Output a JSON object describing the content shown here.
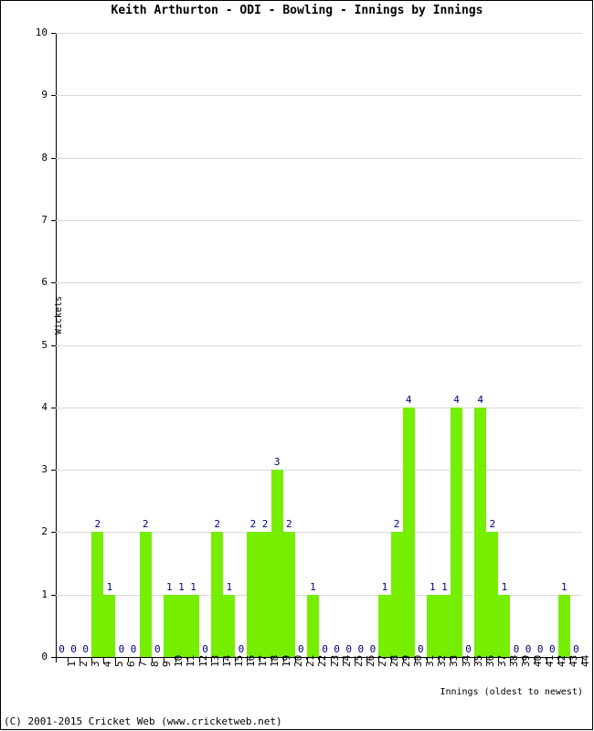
{
  "chart_data": {
    "type": "bar",
    "title": "Keith Arthurton - ODI - Bowling - Innings by Innings",
    "xlabel": "Innings (oldest to newest)",
    "ylabel": "Wickets",
    "ylim": [
      0,
      10
    ],
    "yticks": [
      0,
      1,
      2,
      3,
      4,
      5,
      6,
      7,
      8,
      9,
      10
    ],
    "grid": true,
    "legend": null,
    "bar_color": "#76ee00",
    "label_color": "#000080",
    "categories": [
      1,
      2,
      3,
      4,
      5,
      6,
      7,
      8,
      9,
      10,
      11,
      12,
      13,
      14,
      15,
      16,
      17,
      18,
      19,
      20,
      21,
      22,
      23,
      24,
      25,
      26,
      27,
      28,
      29,
      30,
      31,
      32,
      33,
      34,
      35,
      36,
      37,
      38,
      39,
      40,
      41,
      42,
      43,
      44
    ],
    "values": [
      0,
      0,
      0,
      2,
      1,
      0,
      0,
      2,
      0,
      1,
      1,
      1,
      0,
      2,
      1,
      0,
      2,
      2,
      3,
      2,
      0,
      1,
      0,
      0,
      0,
      0,
      0,
      1,
      2,
      4,
      0,
      1,
      1,
      4,
      0,
      4,
      2,
      1,
      0,
      0,
      0,
      0,
      1,
      0
    ],
    "series": [
      {
        "name": "Wickets",
        "values": [
          0,
          0,
          0,
          2,
          1,
          0,
          0,
          2,
          0,
          1,
          1,
          1,
          0,
          2,
          1,
          0,
          2,
          2,
          3,
          2,
          0,
          1,
          0,
          0,
          0,
          0,
          0,
          1,
          2,
          4,
          0,
          1,
          1,
          4,
          0,
          4,
          2,
          1,
          0,
          0,
          0,
          0,
          1,
          0
        ]
      }
    ]
  },
  "footer": {
    "text": "(C) 2001-2015 Cricket Web (www.cricketweb.net)"
  }
}
